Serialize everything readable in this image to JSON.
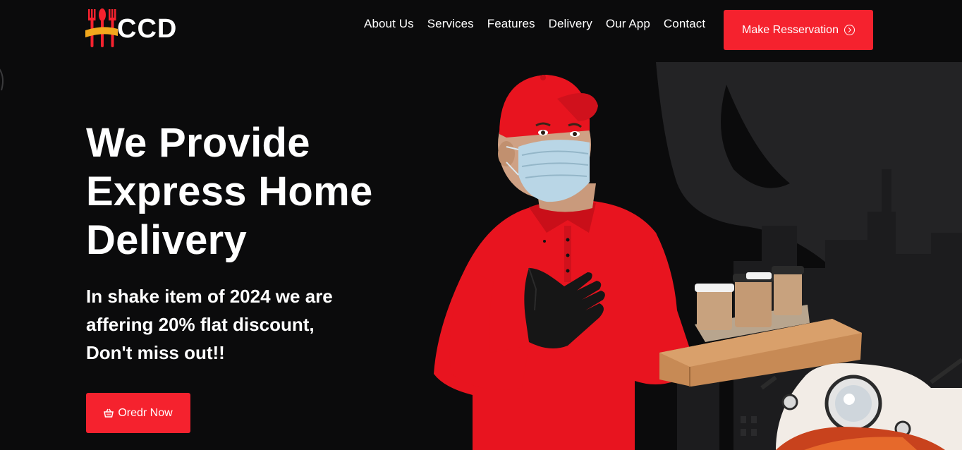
{
  "brand": {
    "name": "CCD"
  },
  "nav": {
    "items": [
      {
        "label": "About Us"
      },
      {
        "label": "Services"
      },
      {
        "label": "Features"
      },
      {
        "label": "Delivery"
      },
      {
        "label": "Our App"
      },
      {
        "label": "Contact"
      }
    ]
  },
  "header": {
    "reserve_label": "Make Resservation",
    "reserve_icon": "arrow-circle-right-icon"
  },
  "hero": {
    "title_lines": [
      "We Provide",
      "Express Home",
      "Delivery"
    ],
    "subtitle_lines": [
      "In shake item of 2024 we are",
      "affering 20% flat discount,",
      "Don't miss out!!"
    ],
    "order_label": "Oredr Now",
    "order_icon": "basket-icon"
  },
  "colors": {
    "accent": "#f5222e",
    "background": "#0b0b0c",
    "text": "#ffffff",
    "logo_yellow": "#f2a81d"
  }
}
